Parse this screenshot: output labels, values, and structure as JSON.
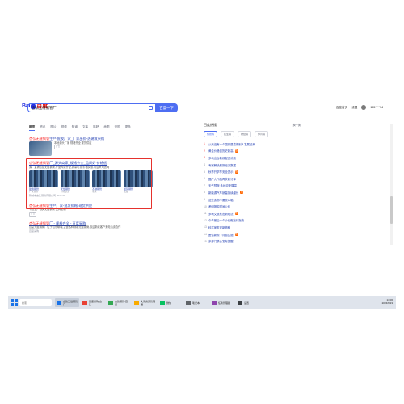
{
  "header": {
    "logo_left": "Bai",
    "logo_right": "百度",
    "query": "杏弘无缝钢管厂",
    "search_button": "百度一下",
    "user_links": [
      "百度首页",
      "设置"
    ],
    "username": "155****14"
  },
  "tabs": [
    "网页",
    "资讯",
    "图片",
    "视频",
    "知道",
    "文库",
    "贴吧",
    "地图",
    "采购",
    "更多"
  ],
  "results": [
    {
      "title_red": "杏弘无缝钢管",
      "title_rest": "生产-批发厂家_厂家出价-选建筑采购",
      "sub": "本地源头厂家 规格齐全 现货供应",
      "meta": "广告"
    },
    {
      "title_red": "杏弘无缝钢管",
      "title_rest": "厂_源头商家_规格齐全_品质好 价格低",
      "sub": "源厂直销杏弘无缝钢管,产品种类齐全,质量可靠,价格实惠,欢迎来电咨询",
      "meta": "聊城市杏弘钢管有限公司 2024-09",
      "images": [
        {
          "cap": "建筑钢管",
          "cap2": "厂家直供"
        },
        {
          "cap": "无缝钢管",
          "cap2": "价格优惠"
        },
        {
          "cap": "不锈钢管",
          "cap2": "现货"
        },
        {
          "cap": "镀锌钢管",
          "cap2": "批发"
        }
      ]
    },
    {
      "title_red": "杏弘无缝钢管",
      "title_rest": "生产厂家-批发价格-现货供应",
      "sub": "专业生产各类无缝钢管 支持定制",
      "meta": "广告"
    },
    {
      "title_red": "杏弘无缝钢管",
      "title_rest": "厂 - 规格齐全 - 百度采购",
      "sub": "杏弘无缝钢管厂位于山东聊城,主营各种规格无缝钢管,欢迎新老客户来电洽谈合作",
      "meta": "百度采购"
    }
  ],
  "sidebar": {
    "title": "百度热搜",
    "refresh": "换一换",
    "tabs": [
      "热搜榜",
      "民生榜",
      "财经榜",
      "体育榜"
    ],
    "items": [
      {
        "num": "1",
        "text": "从来没有一个国家是靠着别人发展起来"
      },
      {
        "num": "2",
        "text": "黄金价格创历史新高"
      },
      {
        "num": "3",
        "text": "多地出台新政促进消费"
      },
      {
        "num": "4",
        "text": "专家解读最新经济数据"
      },
      {
        "num": "5",
        "text": "秋季开学季安全提示"
      },
      {
        "num": "6",
        "text": "国产大飞机再获新订单"
      },
      {
        "num": "7",
        "text": "天气预报:多地迎来降温"
      },
      {
        "num": "8",
        "text": "新能源汽车销量持续增长"
      },
      {
        "num": "9",
        "text": "这些食物不要放冰箱"
      },
      {
        "num": "10",
        "text": "考研报名时间公布"
      },
      {
        "num": "11",
        "text": "多地文旅推出新玩法"
      },
      {
        "num": "12",
        "text": "今年最后一个小长假出行指南"
      },
      {
        "num": "13",
        "text": "科学家发现新物种"
      },
      {
        "num": "14",
        "text": "医保新规下月起实施"
      },
      {
        "num": "15",
        "text": "多部门联合发布提醒"
      }
    ]
  },
  "taskbar": {
    "search": "搜索",
    "tasks": [
      "杏弘无缝钢管厂",
      "百度采购-杏弘",
      "杏弘钢管-百度",
      "文件资源管理器",
      "微信",
      "笔记本",
      "任务管理器",
      "设置"
    ],
    "time": "17:06",
    "date": "2024/9/23"
  },
  "colors": {
    "accent": "#4e6ef2",
    "link": "#2440b3",
    "highlight": "#f73131",
    "box": "#e5322d"
  }
}
